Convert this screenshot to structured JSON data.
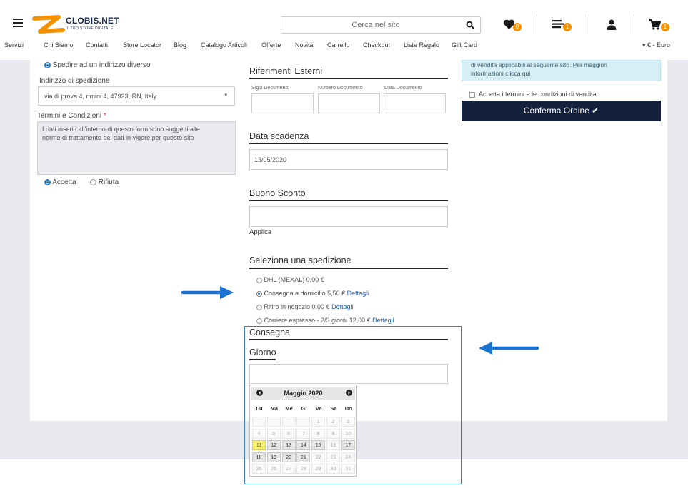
{
  "header": {
    "logo_name": "CLOBIS.NET",
    "logo_tagline": "IL TUO STORE DIGITALE",
    "search_placeholder": "Cerca nel sito",
    "wishlist_count": "0",
    "list_count": "1",
    "cart_count": "1",
    "accent": "#f39200"
  },
  "nav": {
    "items": [
      "Servizi",
      "Chi Siamo",
      "Contatti",
      "Store Locator",
      "Blog",
      "Catalogo Articoli",
      "Offerte",
      "Novità",
      "Carrello",
      "Checkout",
      "Liste Regalo",
      "Gift Card"
    ],
    "currency": "▾ € - Euro"
  },
  "left": {
    "ship_other": "Spedire ad un indirizzo diverso",
    "ship_address_label": "Indirizzo di spedizione",
    "ship_address_value": "via di prova 4, rimini 4, 47923, RN, Italy",
    "terms_label": "Termini e Condizioni",
    "terms_required": "*",
    "terms_text": "I dati inseriti all'interno di questo form sono soggetti alle norme di trattamento dei dati in vigore per questo sito",
    "accept_label": "Accetta",
    "reject_label": "Rifiuta"
  },
  "middle": {
    "ext_refs_title": "Riferimenti Esterni",
    "doc_code_label": "Sigla Documento",
    "doc_number_label": "Numero Documento",
    "doc_date_label": "Data Documento",
    "expiry_title": "Data scadenza",
    "expiry_value": "13/05/2020",
    "coupon_title": "Buono Sconto",
    "apply_label": "Applica",
    "shipping_title": "Seleziona una spedizione",
    "shipping_options": [
      {
        "label": "DHL (MEXAL) 0,00 €",
        "details": ""
      },
      {
        "label": "Consegna a domicilio 5,50 €",
        "details": "Dettagli"
      },
      {
        "label": "Ritiro in negozio 0,00 €",
        "details": "Dettagli"
      },
      {
        "label": "Corriere espresso - 2/3 giorni 12,00 €",
        "details": "Dettagli"
      }
    ],
    "delivery_title": "Consegna",
    "day_title": "Giorno"
  },
  "right": {
    "info_text_1": "di vendita applicabili al seguente sito. Per maggiori",
    "info_text_2": "informazioni",
    "info_link": "clicca qui",
    "accept_terms": "Accetta i termini e le condizioni di vendita",
    "confirm_button": "Conferma Ordine ✔",
    "button_color": "#14213d"
  },
  "calendar": {
    "month_label": "Maggio 2020",
    "weekdays": [
      "Lu",
      "Ma",
      "Me",
      "Gi",
      "Ve",
      "Sa",
      "Do"
    ],
    "weeks": [
      [
        "",
        "",
        "",
        "",
        "1",
        "2",
        "3"
      ],
      [
        "4",
        "5",
        "6",
        "7",
        "8",
        "9",
        "10"
      ],
      [
        "11",
        "12",
        "13",
        "14",
        "15",
        "16",
        "17"
      ],
      [
        "18",
        "19",
        "20",
        "21",
        "22",
        "23",
        "24"
      ],
      [
        "25",
        "26",
        "27",
        "28",
        "29",
        "30",
        "31"
      ]
    ],
    "today": "11",
    "enabled_days": [
      "11",
      "12",
      "13",
      "14",
      "15",
      "17",
      "18",
      "19",
      "20",
      "21"
    ]
  }
}
